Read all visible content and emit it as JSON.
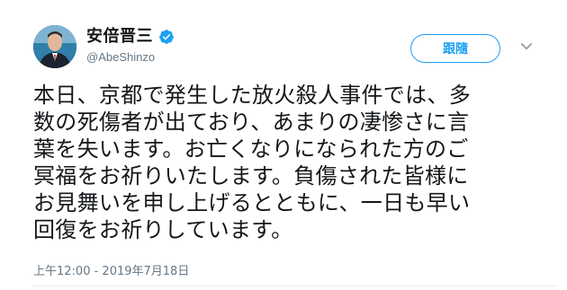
{
  "user": {
    "display_name": "安倍晋三",
    "handle": "@AbeShinzo",
    "verified": true,
    "avatar_icon": "portrait-avatar"
  },
  "actions": {
    "follow_label": "跟隨",
    "more_icon": "chevron-down-icon"
  },
  "tweet": {
    "text": "本日、京都で発生した放火殺人事件では、多\n数の死傷者が出ており、あまりの凄惨さに言\n葉を失います。お亡くなりになられた方のご\n冥福をお祈りいたします。負傷された皆様に\nお見舞いを申し上げるとともに、一日も早い\n回復をお祈りしています。",
    "timestamp": "上午12:00 - 2019年7月18日"
  },
  "colors": {
    "accent": "#1da1f2",
    "text": "#14171a",
    "muted": "#657786",
    "divider": "#e6ecf0"
  }
}
